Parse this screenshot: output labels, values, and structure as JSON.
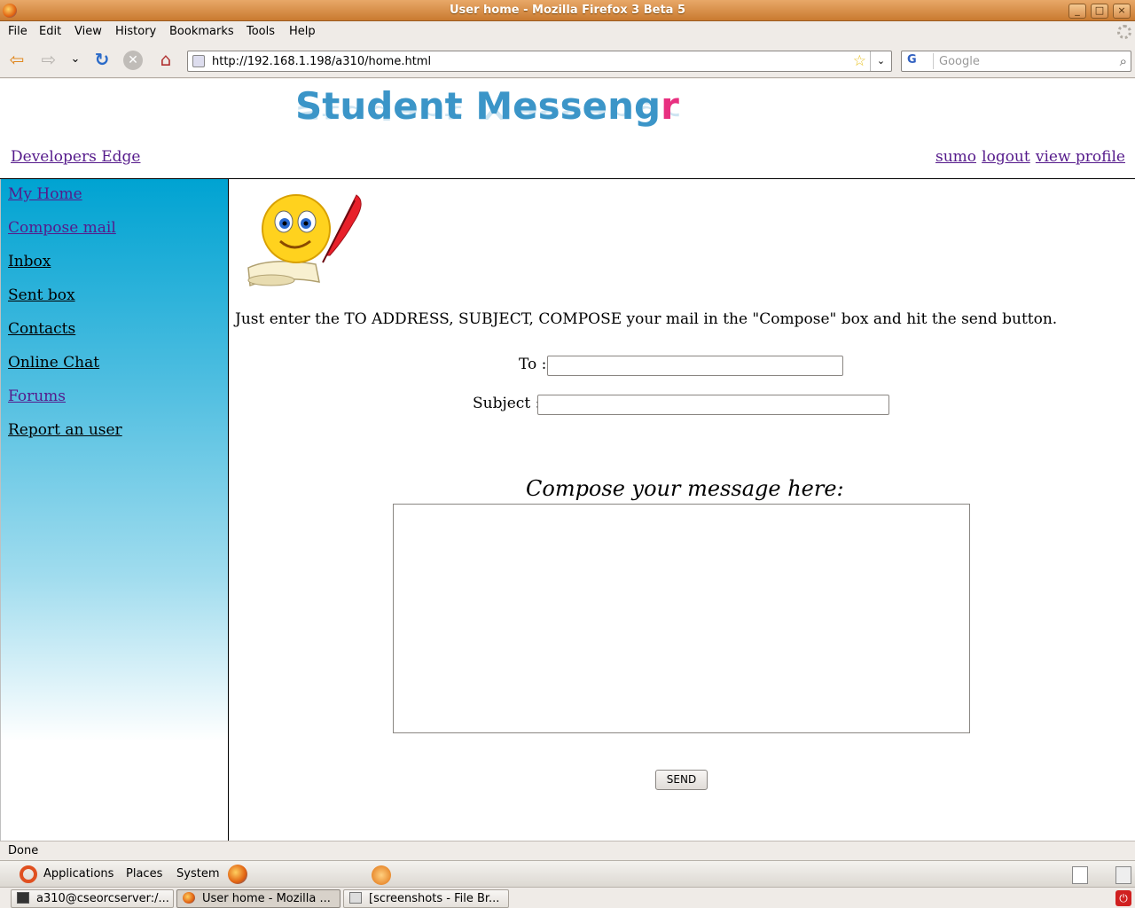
{
  "window": {
    "title": "User home - Mozilla Firefox 3 Beta 5",
    "minimize": "_",
    "maximize": "□",
    "close": "×"
  },
  "menu": {
    "file": "File",
    "edit": "Edit",
    "view": "View",
    "history": "History",
    "bookmarks": "Bookmarks",
    "tools": "Tools",
    "help": "Help"
  },
  "toolbar": {
    "back": "⇦",
    "forward": "⇨",
    "dropdown": "⌄",
    "reload": "↻",
    "stop": "✕",
    "home": "⌂",
    "url": "http://192.168.1.198/a310/home.html",
    "star": "☆",
    "url_dropdown": "⌄",
    "search_engine": "G",
    "search_placeholder": "Google",
    "search_go": "⌕"
  },
  "header": {
    "logo_main": "Student Messeng",
    "logo_accent": "r",
    "left_link": "Developers Edge",
    "user_link": "sumo",
    "logout_link": "logout",
    "profile_link": "view profile"
  },
  "sidebar": {
    "items": [
      "My Home",
      "Compose mail",
      "Inbox",
      "Sent box",
      "Contacts",
      "Online Chat",
      "Forums",
      "Report an user"
    ]
  },
  "compose": {
    "instruction": "Just enter the TO ADDRESS, SUBJECT, COMPOSE your mail in the \"Compose\" box and hit the send button.",
    "to_label": "To :",
    "to_value": "",
    "subject_label": "Subject :",
    "subject_value": "",
    "compose_heading": "Compose your message here:",
    "message_value": "",
    "send_label": "SEND"
  },
  "status": {
    "text": "Done"
  },
  "panel": {
    "applications": "Applications",
    "places": "Places",
    "system": "System"
  },
  "taskbar": {
    "tasks": [
      "a310@cseorcserver:/...",
      "User home - Mozilla ...",
      "[screenshots - File Br..."
    ]
  },
  "colors": {
    "sidebar_top": "#00a3d2",
    "logo": "#3b95c8",
    "logo_accent": "#e83080",
    "visited_link": "#551a8b",
    "title_bar": "#d88a40"
  }
}
